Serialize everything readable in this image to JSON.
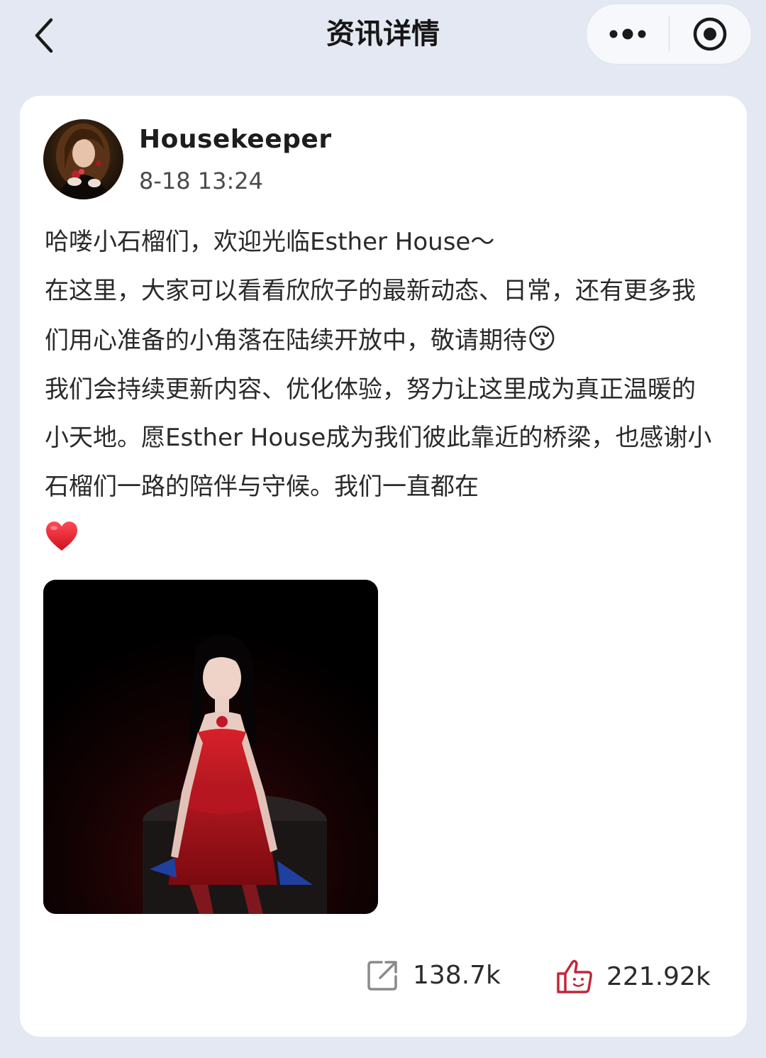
{
  "nav": {
    "title": "资讯详情",
    "back_icon": "chevron-left-icon",
    "more_icon": "more-dots-icon",
    "close_icon": "target-close-icon"
  },
  "post": {
    "author": "Housekeeper",
    "time": "8-18 13:24",
    "paragraphs": [
      "哈喽小石榴们，欢迎光临Esther House～",
      "在这里，大家可以看看欣欣子的最新动态、日常，还有更多我们用心准备的小角落在陆续开放中，敬请期待",
      "我们会持续更新内容、优化体验，努力让这里成为真正温暖的小天地。愿Esther House成为我们彼此靠近的桥梁，也感谢小石榴们一路的陪伴与守候。我们一直都在"
    ],
    "emoji_kiss": "😚",
    "heart_icon": "red-heart-icon"
  },
  "stats": {
    "shares": "138.7k",
    "likes": "221.92k"
  },
  "colors": {
    "page_bg": "#e4e8f2",
    "card_bg": "#ffffff",
    "like_icon": "#c0283a",
    "share_icon": "#8a8a8a"
  }
}
